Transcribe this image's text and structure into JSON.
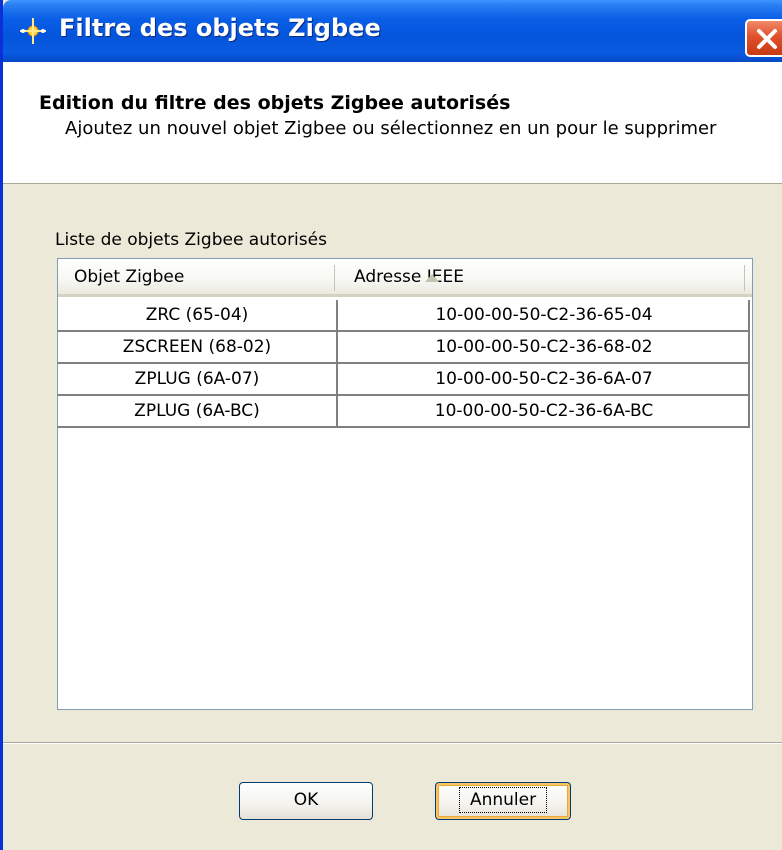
{
  "window": {
    "title": "Filtre des objets Zigbee"
  },
  "banner": {
    "title": "Edition du filtre des objets Zigbee autorisés",
    "subtitle": "Ajoutez un nouvel objet Zigbee ou sélectionnez en un pour le supprimer"
  },
  "list": {
    "label": "Liste de objets Zigbee autorisés",
    "columns": [
      "Objet Zigbee",
      "Adresse IEEE"
    ],
    "sort": {
      "column": "Adresse IEEE",
      "direction": "ascending"
    },
    "rows": [
      {
        "object": "ZRC (65-04)",
        "address": "10-00-00-50-C2-36-65-04"
      },
      {
        "object": "ZSCREEN (68-02)",
        "address": "10-00-00-50-C2-36-68-02"
      },
      {
        "object": "ZPLUG (6A-07)",
        "address": "10-00-00-50-C2-36-6A-07"
      },
      {
        "object": "ZPLUG (6A-BC)",
        "address": "10-00-00-50-C2-36-6A-BC"
      }
    ]
  },
  "buttons": {
    "ok": "OK",
    "cancel": "Annuler"
  },
  "icons": {
    "app": "sparkle-icon",
    "close": "close-icon",
    "sort": "sort-ascending-icon"
  },
  "colors": {
    "titlebar": "#0454dc",
    "close_button": "#e0512c",
    "dialog_background": "#ece9d8"
  }
}
